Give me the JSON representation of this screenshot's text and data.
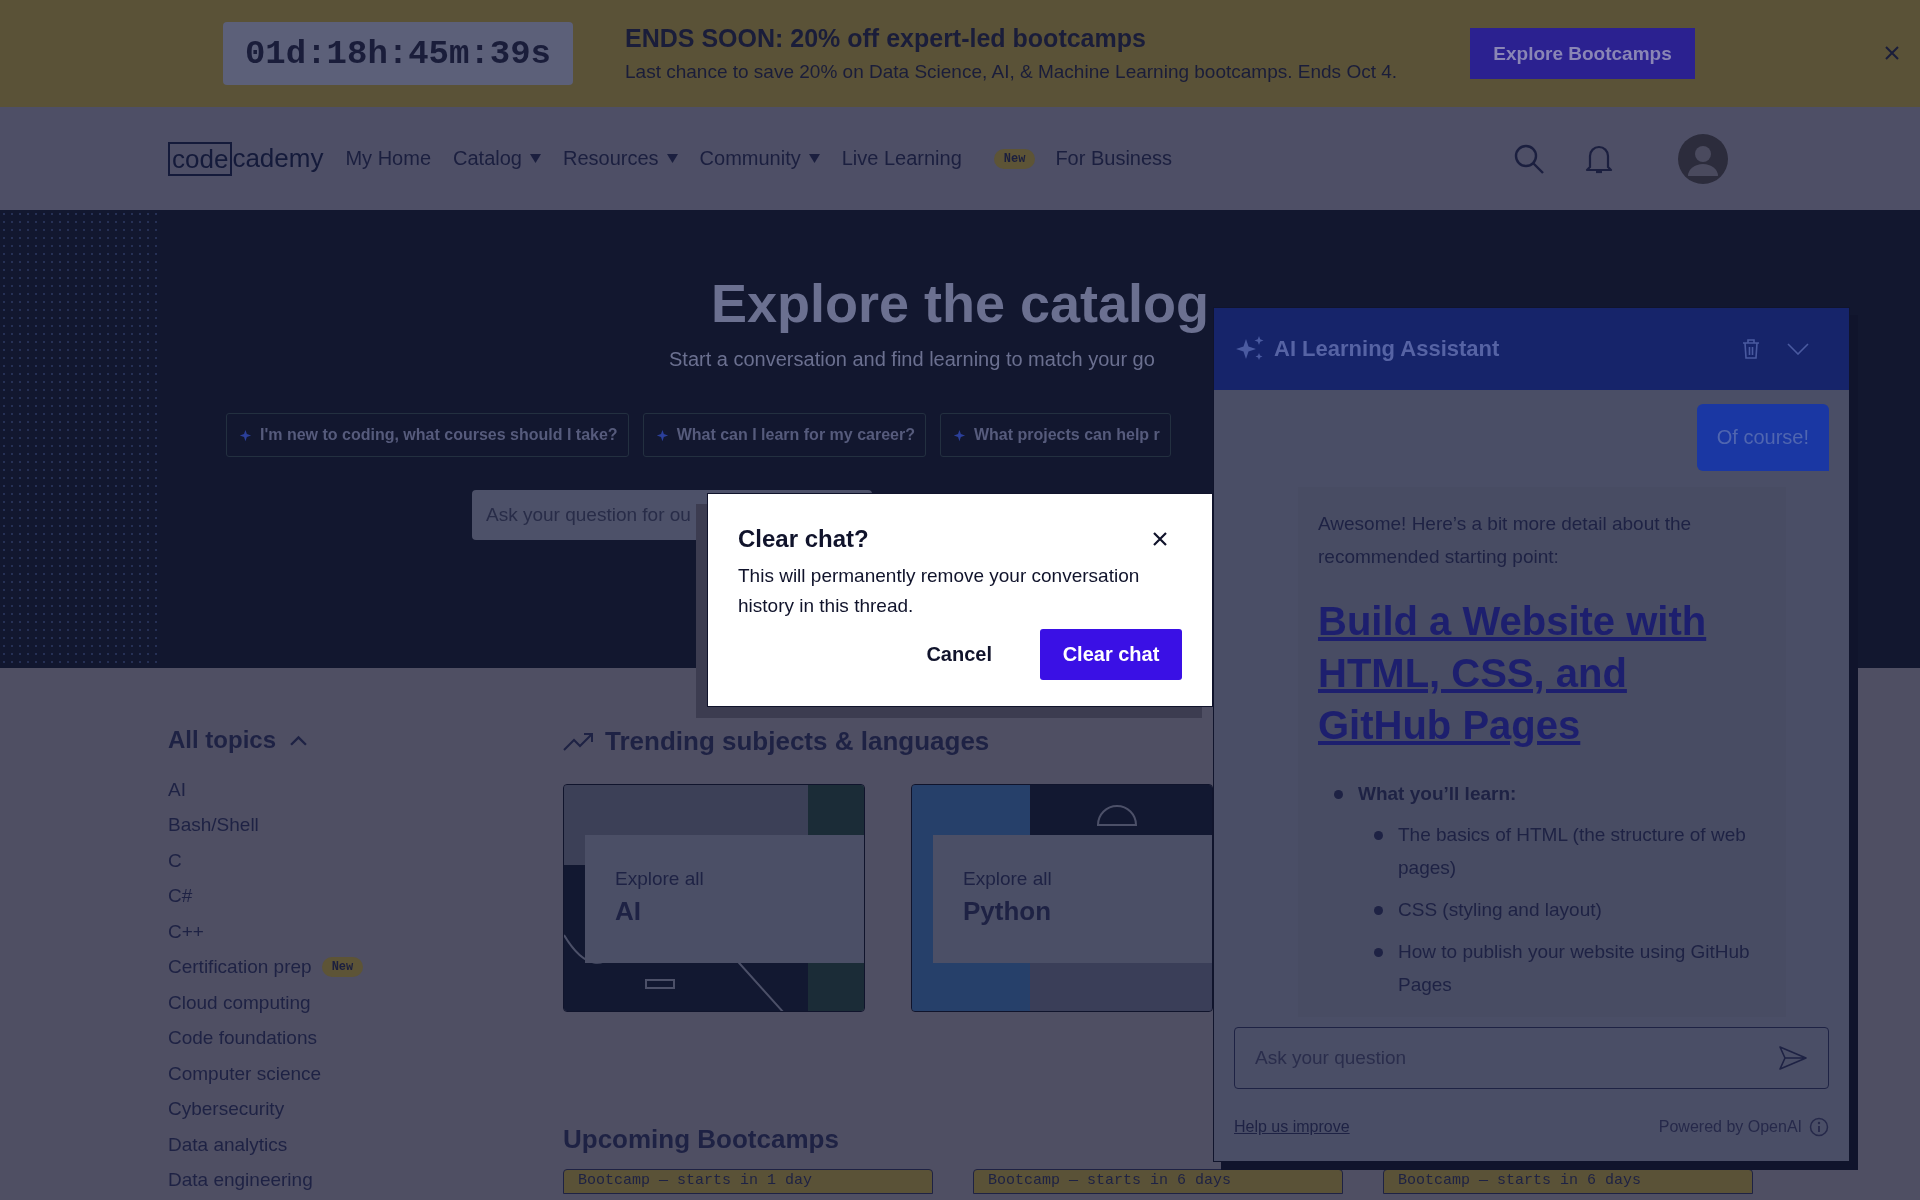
{
  "banner": {
    "countdown": "01d:18h:45m:39s",
    "title": "ENDS SOON: 20% off expert-led bootcamps",
    "text": "Last chance to save 20% on Data Science, AI, & Machine Learning bootcamps. Ends Oct 4.",
    "button": "Explore Bootcamps"
  },
  "nav": {
    "logo": [
      "code",
      "cademy"
    ],
    "items": [
      {
        "label": "My Home",
        "dropdown": false
      },
      {
        "label": "Catalog",
        "dropdown": true
      },
      {
        "label": "Resources",
        "dropdown": true
      },
      {
        "label": "Community",
        "dropdown": true
      },
      {
        "label": "Live Learning",
        "dropdown": false,
        "badge": "New"
      },
      {
        "label": "For Business",
        "dropdown": false
      }
    ]
  },
  "hero": {
    "title": "Explore the catalog",
    "subtitle": "Start a conversation and find learning to match your go",
    "chips": [
      "I'm new to coding, what courses should I take?",
      "What can I learn for my career?",
      "What projects can help r"
    ],
    "placeholder": "Ask your question for ou"
  },
  "sidebar": {
    "heading": "All topics",
    "expanded": true,
    "items": [
      {
        "label": "AI"
      },
      {
        "label": "Bash/Shell"
      },
      {
        "label": "C"
      },
      {
        "label": "C#"
      },
      {
        "label": "C++"
      },
      {
        "label": "Certification prep",
        "badge": "New"
      },
      {
        "label": "Cloud computing"
      },
      {
        "label": "Code foundations"
      },
      {
        "label": "Computer science"
      },
      {
        "label": "Cybersecurity"
      },
      {
        "label": "Data analytics"
      },
      {
        "label": "Data engineering"
      }
    ]
  },
  "trending": {
    "heading": "Trending subjects & languages",
    "cards": [
      {
        "eyebrow": "Explore all",
        "title": "AI",
        "kind": "ai"
      },
      {
        "eyebrow": "Explore all",
        "title": "Python",
        "kind": "python"
      }
    ]
  },
  "upcoming": {
    "heading": "Upcoming Bootcamps",
    "tabs": [
      "Bootcamp — starts in 1 day",
      "Bootcamp — starts in 6 days",
      "Bootcamp — starts in 6 days"
    ]
  },
  "chat": {
    "title": "AI Learning Assistant",
    "user_message": "Of course!",
    "reply": {
      "intro": "Awesome! Here’s a bit more detail about the recommended starting point:",
      "link": "Build a Website with HTML, CSS, and GitHub Pages",
      "list": [
        {
          "label": "What you’ll learn:",
          "children": [
            {
              "label": "The basics of HTML (the structure of web pages)"
            },
            {
              "label": "CSS (styling and layout)"
            },
            {
              "label": "How to publish your website using GitHub Pages"
            }
          ]
        }
      ]
    },
    "placeholder": "Ask your question",
    "help_link": "Help us improve",
    "powered": "Powered by OpenAI"
  },
  "modal": {
    "title": "Clear chat?",
    "body": "This will permanently remove your conversation history in this thread.",
    "cancel": "Cancel",
    "confirm": "Clear chat"
  }
}
